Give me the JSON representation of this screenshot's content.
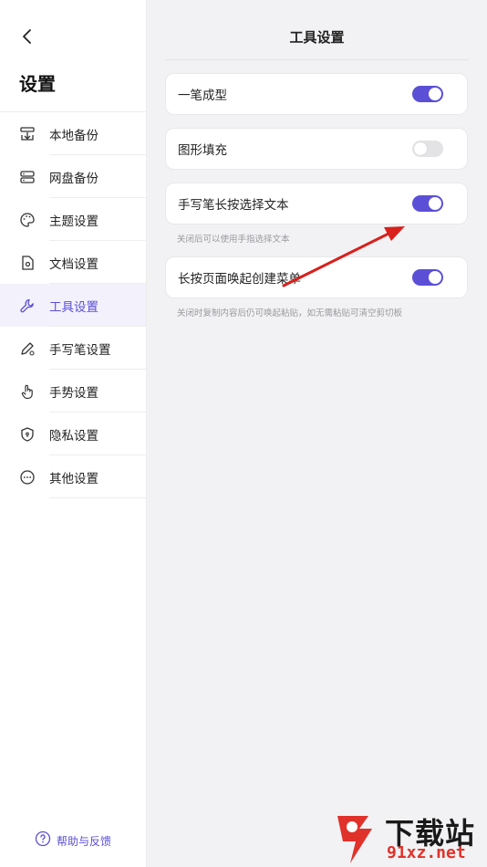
{
  "sidebar": {
    "title": "设置",
    "items": [
      {
        "label": "本地备份",
        "icon": "local-backup-icon"
      },
      {
        "label": "网盘备份",
        "icon": "cloud-backup-icon"
      },
      {
        "label": "主题设置",
        "icon": "palette-icon"
      },
      {
        "label": "文档设置",
        "icon": "document-settings-icon"
      },
      {
        "label": "工具设置",
        "icon": "wrench-icon",
        "active": true
      },
      {
        "label": "手写笔设置",
        "icon": "pen-settings-icon"
      },
      {
        "label": "手势设置",
        "icon": "hand-gesture-icon"
      },
      {
        "label": "隐私设置",
        "icon": "shield-icon"
      },
      {
        "label": "其他设置",
        "icon": "more-icon"
      }
    ],
    "help_label": "帮助与反馈"
  },
  "main": {
    "title": "工具设置",
    "settings": [
      {
        "label": "一笔成型",
        "enabled": true
      },
      {
        "label": "图形填充",
        "enabled": false
      },
      {
        "label": "手写笔长按选择文本",
        "enabled": true,
        "hint": "关闭后可以使用手指选择文本"
      },
      {
        "label": "长按页面唤起创建菜单",
        "enabled": true,
        "hint": "关闭时复制内容后仍可唤起粘贴，如无需粘贴可清空剪切板"
      }
    ]
  },
  "watermark": {
    "text": "下载站",
    "sub": "91xz.net"
  },
  "colors": {
    "accent": "#5b4fd6",
    "annotation_arrow": "#d8201c"
  }
}
